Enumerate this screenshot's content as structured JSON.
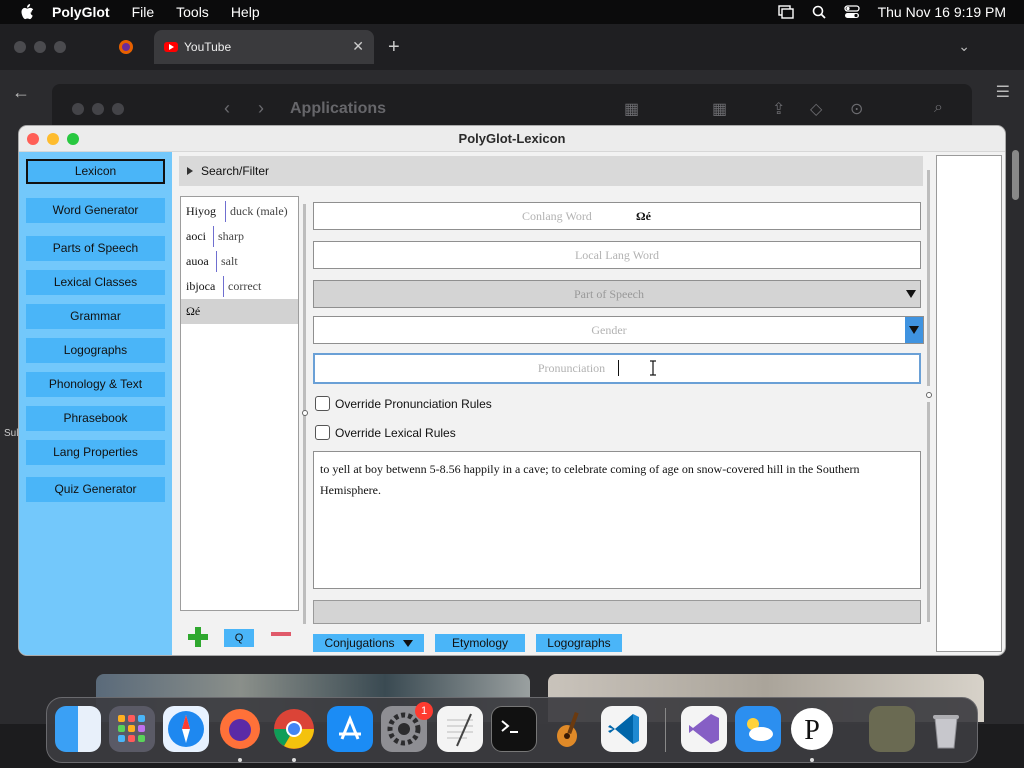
{
  "menubar": {
    "app_name": "PolyGlot",
    "menus": [
      "File",
      "Tools",
      "Help"
    ],
    "datetime": "Thu Nov 16  9:19 PM"
  },
  "browser": {
    "tab_title": "YouTube",
    "finder_title": "Applications",
    "side_text": "Sul"
  },
  "window": {
    "title": "PolyGlot-Lexicon"
  },
  "sidebar": {
    "items": [
      {
        "label": "Lexicon",
        "active": true
      },
      {
        "label": "Word Generator"
      },
      {
        "label": "Parts of Speech"
      },
      {
        "label": "Lexical Classes"
      },
      {
        "label": "Grammar"
      },
      {
        "label": "Logographs"
      },
      {
        "label": "Phonology & Text"
      },
      {
        "label": "Phrasebook"
      },
      {
        "label": "Lang Properties"
      },
      {
        "label": "Quiz Generator"
      }
    ]
  },
  "search": {
    "label": "Search/Filter"
  },
  "words": [
    {
      "conword": "Hiyog",
      "local": "duck (male)"
    },
    {
      "conword": "aoci",
      "local": "sharp"
    },
    {
      "conword": "auoa",
      "local": "salt"
    },
    {
      "conword": "ibjoca",
      "local": "correct"
    },
    {
      "conword": "Ωé",
      "local": "",
      "selected": true
    }
  ],
  "list_buttons": {
    "filter_label": "Q"
  },
  "form": {
    "conlang_word_placeholder": "Conlang Word",
    "conlang_word_value": "Ωé",
    "local_word_placeholder": "Local Lang Word",
    "part_of_speech_placeholder": "Part of Speech",
    "gender_placeholder": "Gender",
    "pronunciation_placeholder": "Pronunciation",
    "override_pronunciation_label": "Override Pronunciation Rules",
    "override_lexical_label": "Override Lexical Rules",
    "definition": "to yell at boy betwenn 5-8.56 happily in a cave; to celebrate coming of age on snow-covered hill in the Southern Hemisphere."
  },
  "bottom_tabs": {
    "conjugations": "Conjugations",
    "etymology": "Etymology",
    "logographs": "Logographs"
  },
  "dock": {
    "badge_count": "1"
  },
  "colors": {
    "sidebar_bg": "#73c8fb",
    "button_blue": "#4ab5f8",
    "add_green": "#2fa82f",
    "delete_red": "#e05a6a"
  }
}
